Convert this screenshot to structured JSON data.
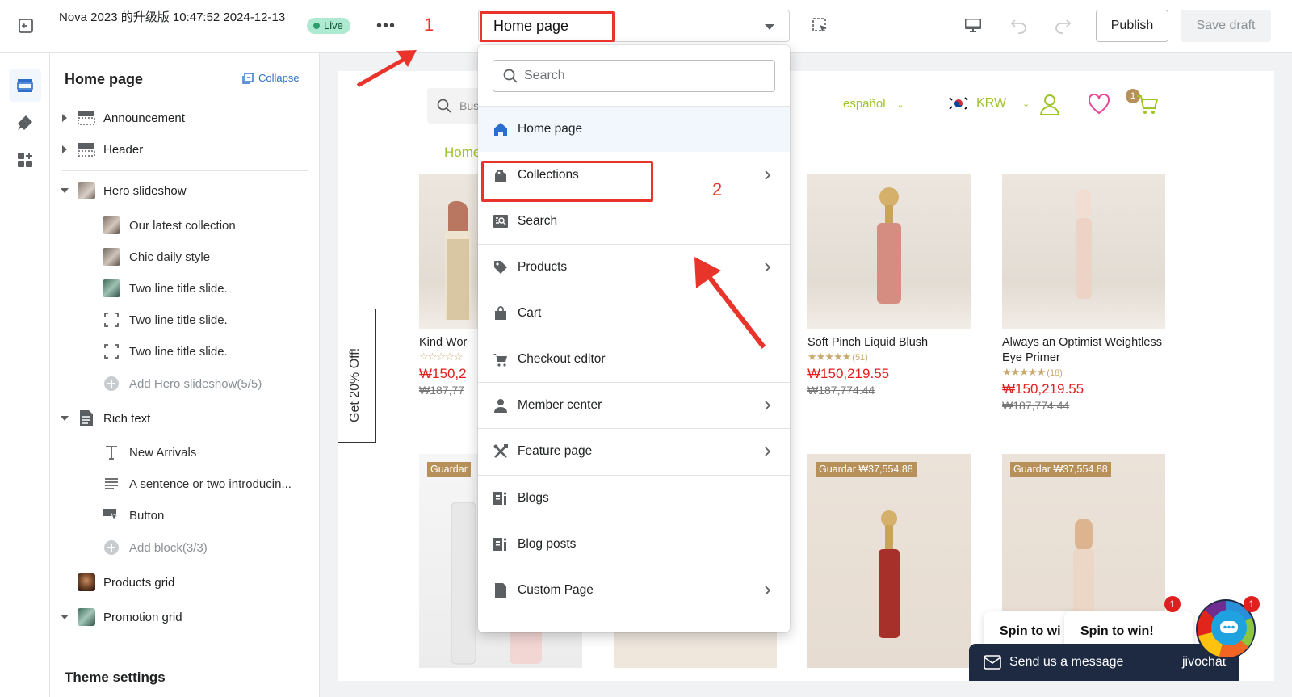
{
  "topbar": {
    "theme_name": "Nova 2023 的升级版 10:47:52 2024-12-13",
    "live_label": "Live",
    "more_label": "•••",
    "annotation_1": "1",
    "page_select_value": "Home page",
    "publish_label": "Publish",
    "save_draft_label": "Save draft"
  },
  "sidebar": {
    "title": "Home page",
    "collapse_label": "Collapse",
    "sections": [
      {
        "label": "Announcement"
      },
      {
        "label": "Header"
      },
      {
        "label": "Hero slideshow"
      },
      {
        "label": "Rich text"
      },
      {
        "label": "Products grid"
      },
      {
        "label": "Promotion grid"
      }
    ],
    "hero_blocks": [
      {
        "label": "Our latest collection"
      },
      {
        "label": "Chic daily style"
      },
      {
        "label": "Two line title slide."
      },
      {
        "label": "Two line title slide."
      },
      {
        "label": "Two line title slide."
      },
      {
        "label": "Add Hero slideshow(5/5)"
      }
    ],
    "rich_text_blocks": [
      {
        "label": "New Arrivals"
      },
      {
        "label": "A sentence or two introducin..."
      },
      {
        "label": "Button"
      },
      {
        "label": "Add block(3/3)"
      }
    ],
    "theme_settings_label": "Theme settings"
  },
  "dropdown": {
    "search_placeholder": "Search",
    "annotation_2": "2",
    "items": [
      {
        "label": "Home page",
        "icon": "home-icon",
        "selected": true,
        "has_submenu": false
      },
      {
        "label": "Collections",
        "icon": "collections-icon",
        "selected": false,
        "has_submenu": true
      },
      {
        "label": "Search",
        "icon": "search-page-icon",
        "selected": false,
        "has_submenu": false
      },
      {
        "label": "Products",
        "icon": "tag-icon",
        "selected": false,
        "has_submenu": true
      },
      {
        "label": "Cart",
        "icon": "bag-icon",
        "selected": false,
        "has_submenu": false
      },
      {
        "label": "Checkout editor",
        "icon": "cart-icon",
        "selected": false,
        "has_submenu": false
      },
      {
        "label": "Member center",
        "icon": "person-icon",
        "selected": false,
        "has_submenu": true
      },
      {
        "label": "Feature page",
        "icon": "tools-icon",
        "selected": false,
        "has_submenu": true
      },
      {
        "label": "Blogs",
        "icon": "blog-icon",
        "selected": false,
        "has_submenu": false
      },
      {
        "label": "Blog posts",
        "icon": "blog-post-icon",
        "selected": false,
        "has_submenu": false
      },
      {
        "label": "Custom Page",
        "icon": "page-icon",
        "selected": false,
        "has_submenu": true
      }
    ]
  },
  "store": {
    "search_placeholder": "Bus",
    "language": "español",
    "currency": "KRW",
    "nav_home": "Home",
    "wishlist_count": "1",
    "side_tab": "Get 20% Off!",
    "products_row1": [
      {
        "name": "Kind Wor",
        "rating": "☆☆☆☆☆",
        "reviews": "",
        "price": "₩150,2",
        "old_price": "₩187,77"
      },
      {
        "name": "Soft Pinch Liquid Blush",
        "rating": "★★★★★",
        "reviews": "(51)",
        "price": "₩150,219.55",
        "old_price": "₩187,774.44"
      },
      {
        "name": "Always an Optimist Weightless Eye Primer",
        "rating": "★★★★★",
        "reviews": "(18)",
        "price": "₩150,219.55",
        "old_price": "₩187,774.44"
      }
    ],
    "products_row2": [
      {
        "badge": "Guardar"
      },
      {
        "badge": "Guardar ₩37,554.88"
      },
      {
        "badge": "Guardar ₩37,554.88"
      }
    ]
  },
  "chat": {
    "spin_1": "Spin to wi",
    "spin_2": "Spin to win!",
    "message_label": "Send us a message",
    "brand": "jivochat",
    "badge_1": "1",
    "badge_2": "1"
  },
  "colors": {
    "accent": "#2c6ecb",
    "annotation_red": "#e8342b",
    "store_green": "#9ec427",
    "price_red": "#e0201f"
  }
}
